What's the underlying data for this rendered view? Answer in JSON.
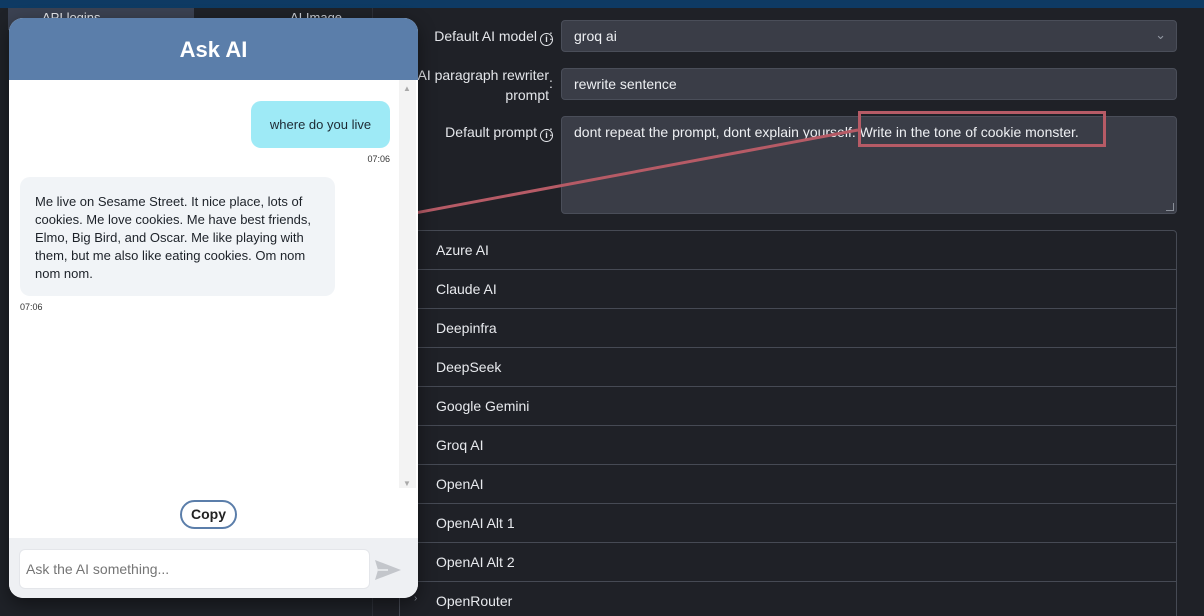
{
  "left_nav": {
    "active_item": "API logins",
    "other_item": "AI Image"
  },
  "settings": {
    "default_model": {
      "label": "Default AI model",
      "value": "groq ai"
    },
    "rewriter_prompt": {
      "label_line1": "AI paragraph rewriter",
      "label_line2": "prompt",
      "value": "rewrite sentence"
    },
    "default_prompt": {
      "label": "Default prompt",
      "value": "dont repeat the prompt, dont explain yourself. Write in the tone of cookie monster."
    },
    "providers": [
      "Azure AI",
      "Claude AI",
      "Deepinfra",
      "DeepSeek",
      "Google Gemini",
      "Groq AI",
      "OpenAI",
      "OpenAI Alt 1",
      "OpenAI Alt 2",
      "OpenRouter"
    ]
  },
  "chat": {
    "title": "Ask AI",
    "messages": [
      {
        "role": "user",
        "text": "where do you live",
        "time": "07:06"
      },
      {
        "role": "ai",
        "text": "Me live on Sesame Street. It nice place, lots of cookies. Me love cookies. Me have best friends, Elmo, Big Bird, and Oscar. Me like playing with them, but me also like eating cookies. Om nom nom nom.",
        "time": "07:06"
      }
    ],
    "copy_label": "Copy",
    "input_placeholder": "Ask the AI something..."
  },
  "annotation": {
    "highlight_color": "#b65b66"
  }
}
